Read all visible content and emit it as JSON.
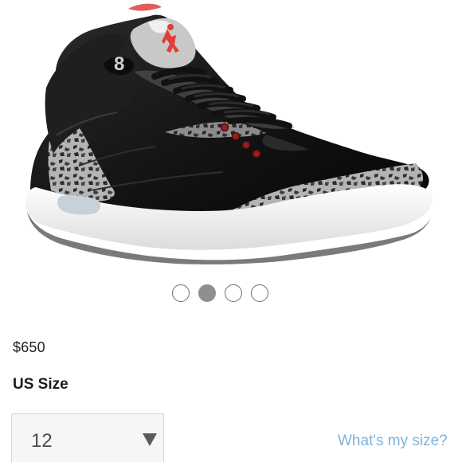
{
  "product": {
    "image_alt": "Black cement sneaker with red accents",
    "carousel": {
      "dots": [
        "1",
        "2",
        "3",
        "4"
      ],
      "active_index": 1
    },
    "price": "$650",
    "size": {
      "label": "US Size",
      "selected": "12",
      "help_link": "What's my size?"
    }
  },
  "colors": {
    "leather": "#151515",
    "cement": "#a3a3a3",
    "sole": "#f4f4f4",
    "accent": "#d73b3b",
    "link": "#7fb2d9",
    "dot_active": "#8f8f8f"
  }
}
